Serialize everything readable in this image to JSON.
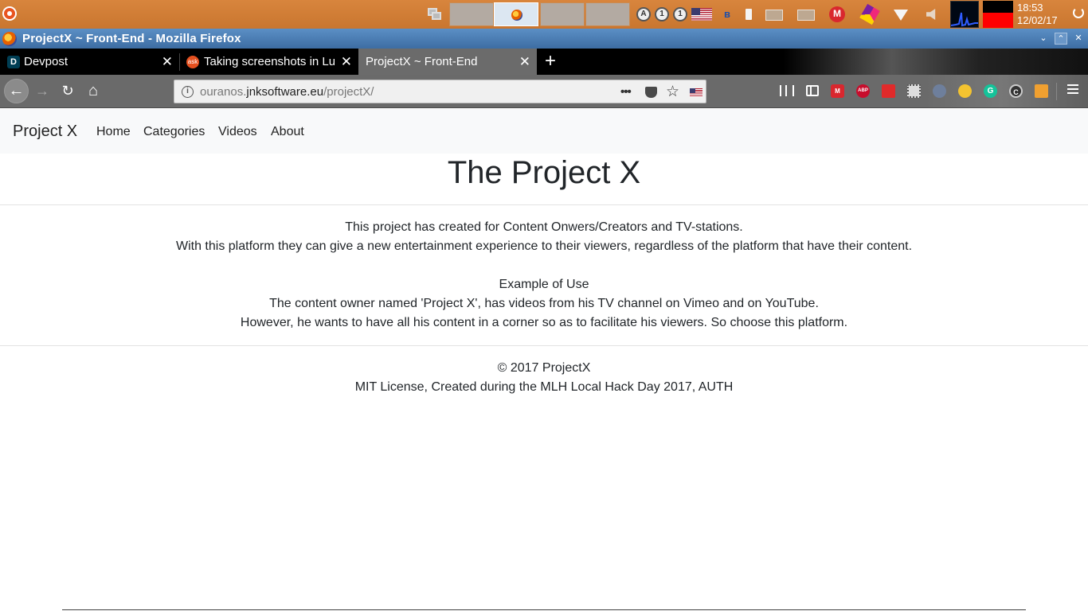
{
  "desktop": {
    "clock_time": "18:53",
    "clock_date": "12/02/17",
    "tray_letters": [
      "A",
      "1",
      "1"
    ],
    "mega_label": "M",
    "bluetooth_glyph": "ʙ"
  },
  "window": {
    "title": "ProjectX ~ Front-End - Mozilla Firefox",
    "minimize": "⌄",
    "maximize": "⌃",
    "close": "✕"
  },
  "tabs": [
    {
      "label": "Devpost",
      "favicon": "D"
    },
    {
      "label": "Taking screenshots in Lub",
      "favicon": "ask"
    },
    {
      "label": "ProjectX ~ Front-End",
      "favicon": ""
    }
  ],
  "tab_close_glyph": "✕",
  "new_tab_glyph": "+",
  "nav": {
    "back": "←",
    "forward": "→",
    "reload": "↻",
    "home": "⌂",
    "info": "i",
    "url_prefix": "ouranos.",
    "url_host": "jnksoftware.eu",
    "url_path": "/projectX/",
    "page_actions": "•••",
    "star": "☆"
  },
  "toolbar_icons": {
    "mega": "M",
    "adblock": "ABP",
    "grammarly": "G",
    "circle_c": "C"
  },
  "site": {
    "brand": "Project X",
    "links": [
      "Home",
      "Categories",
      "Videos",
      "About"
    ],
    "title": "The Project X",
    "intro": [
      "This project has created for Content Onwers/Creators and TV-stations.",
      "With this platform they can give a new entertainment experience to their viewers, regardless of the platform that have their content."
    ],
    "example_heading": "Example of Use",
    "example": [
      "The content owner named 'Project X', has videos from his TV channel on Vimeo and on YouTube.",
      "However, he wants to have all his content in a corner so as to facilitate his viewers. So choose this platform."
    ],
    "footer": [
      "© 2017 ProjectX",
      "MIT License, Created during the MLH Local Hack Day 2017, AUTH"
    ]
  },
  "colors": {
    "panel": "#c9762f",
    "titlebar": "#3d6da3",
    "navbar_bg": "#f8f9fa",
    "text": "#212529"
  }
}
